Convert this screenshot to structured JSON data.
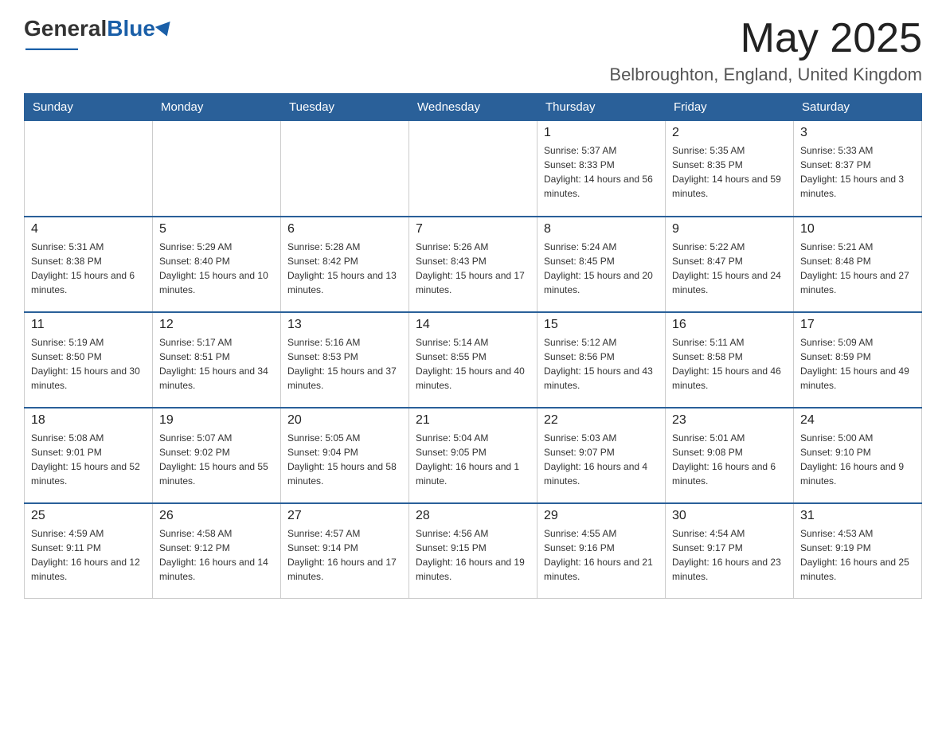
{
  "header": {
    "logo_general": "General",
    "logo_blue": "Blue",
    "month_title": "May 2025",
    "location": "Belbroughton, England, United Kingdom"
  },
  "weekdays": [
    "Sunday",
    "Monday",
    "Tuesday",
    "Wednesday",
    "Thursday",
    "Friday",
    "Saturday"
  ],
  "weeks": [
    [
      {
        "day": "",
        "sunrise": "",
        "sunset": "",
        "daylight": ""
      },
      {
        "day": "",
        "sunrise": "",
        "sunset": "",
        "daylight": ""
      },
      {
        "day": "",
        "sunrise": "",
        "sunset": "",
        "daylight": ""
      },
      {
        "day": "",
        "sunrise": "",
        "sunset": "",
        "daylight": ""
      },
      {
        "day": "1",
        "sunrise": "Sunrise: 5:37 AM",
        "sunset": "Sunset: 8:33 PM",
        "daylight": "Daylight: 14 hours and 56 minutes."
      },
      {
        "day": "2",
        "sunrise": "Sunrise: 5:35 AM",
        "sunset": "Sunset: 8:35 PM",
        "daylight": "Daylight: 14 hours and 59 minutes."
      },
      {
        "day": "3",
        "sunrise": "Sunrise: 5:33 AM",
        "sunset": "Sunset: 8:37 PM",
        "daylight": "Daylight: 15 hours and 3 minutes."
      }
    ],
    [
      {
        "day": "4",
        "sunrise": "Sunrise: 5:31 AM",
        "sunset": "Sunset: 8:38 PM",
        "daylight": "Daylight: 15 hours and 6 minutes."
      },
      {
        "day": "5",
        "sunrise": "Sunrise: 5:29 AM",
        "sunset": "Sunset: 8:40 PM",
        "daylight": "Daylight: 15 hours and 10 minutes."
      },
      {
        "day": "6",
        "sunrise": "Sunrise: 5:28 AM",
        "sunset": "Sunset: 8:42 PM",
        "daylight": "Daylight: 15 hours and 13 minutes."
      },
      {
        "day": "7",
        "sunrise": "Sunrise: 5:26 AM",
        "sunset": "Sunset: 8:43 PM",
        "daylight": "Daylight: 15 hours and 17 minutes."
      },
      {
        "day": "8",
        "sunrise": "Sunrise: 5:24 AM",
        "sunset": "Sunset: 8:45 PM",
        "daylight": "Daylight: 15 hours and 20 minutes."
      },
      {
        "day": "9",
        "sunrise": "Sunrise: 5:22 AM",
        "sunset": "Sunset: 8:47 PM",
        "daylight": "Daylight: 15 hours and 24 minutes."
      },
      {
        "day": "10",
        "sunrise": "Sunrise: 5:21 AM",
        "sunset": "Sunset: 8:48 PM",
        "daylight": "Daylight: 15 hours and 27 minutes."
      }
    ],
    [
      {
        "day": "11",
        "sunrise": "Sunrise: 5:19 AM",
        "sunset": "Sunset: 8:50 PM",
        "daylight": "Daylight: 15 hours and 30 minutes."
      },
      {
        "day": "12",
        "sunrise": "Sunrise: 5:17 AM",
        "sunset": "Sunset: 8:51 PM",
        "daylight": "Daylight: 15 hours and 34 minutes."
      },
      {
        "day": "13",
        "sunrise": "Sunrise: 5:16 AM",
        "sunset": "Sunset: 8:53 PM",
        "daylight": "Daylight: 15 hours and 37 minutes."
      },
      {
        "day": "14",
        "sunrise": "Sunrise: 5:14 AM",
        "sunset": "Sunset: 8:55 PM",
        "daylight": "Daylight: 15 hours and 40 minutes."
      },
      {
        "day": "15",
        "sunrise": "Sunrise: 5:12 AM",
        "sunset": "Sunset: 8:56 PM",
        "daylight": "Daylight: 15 hours and 43 minutes."
      },
      {
        "day": "16",
        "sunrise": "Sunrise: 5:11 AM",
        "sunset": "Sunset: 8:58 PM",
        "daylight": "Daylight: 15 hours and 46 minutes."
      },
      {
        "day": "17",
        "sunrise": "Sunrise: 5:09 AM",
        "sunset": "Sunset: 8:59 PM",
        "daylight": "Daylight: 15 hours and 49 minutes."
      }
    ],
    [
      {
        "day": "18",
        "sunrise": "Sunrise: 5:08 AM",
        "sunset": "Sunset: 9:01 PM",
        "daylight": "Daylight: 15 hours and 52 minutes."
      },
      {
        "day": "19",
        "sunrise": "Sunrise: 5:07 AM",
        "sunset": "Sunset: 9:02 PM",
        "daylight": "Daylight: 15 hours and 55 minutes."
      },
      {
        "day": "20",
        "sunrise": "Sunrise: 5:05 AM",
        "sunset": "Sunset: 9:04 PM",
        "daylight": "Daylight: 15 hours and 58 minutes."
      },
      {
        "day": "21",
        "sunrise": "Sunrise: 5:04 AM",
        "sunset": "Sunset: 9:05 PM",
        "daylight": "Daylight: 16 hours and 1 minute."
      },
      {
        "day": "22",
        "sunrise": "Sunrise: 5:03 AM",
        "sunset": "Sunset: 9:07 PM",
        "daylight": "Daylight: 16 hours and 4 minutes."
      },
      {
        "day": "23",
        "sunrise": "Sunrise: 5:01 AM",
        "sunset": "Sunset: 9:08 PM",
        "daylight": "Daylight: 16 hours and 6 minutes."
      },
      {
        "day": "24",
        "sunrise": "Sunrise: 5:00 AM",
        "sunset": "Sunset: 9:10 PM",
        "daylight": "Daylight: 16 hours and 9 minutes."
      }
    ],
    [
      {
        "day": "25",
        "sunrise": "Sunrise: 4:59 AM",
        "sunset": "Sunset: 9:11 PM",
        "daylight": "Daylight: 16 hours and 12 minutes."
      },
      {
        "day": "26",
        "sunrise": "Sunrise: 4:58 AM",
        "sunset": "Sunset: 9:12 PM",
        "daylight": "Daylight: 16 hours and 14 minutes."
      },
      {
        "day": "27",
        "sunrise": "Sunrise: 4:57 AM",
        "sunset": "Sunset: 9:14 PM",
        "daylight": "Daylight: 16 hours and 17 minutes."
      },
      {
        "day": "28",
        "sunrise": "Sunrise: 4:56 AM",
        "sunset": "Sunset: 9:15 PM",
        "daylight": "Daylight: 16 hours and 19 minutes."
      },
      {
        "day": "29",
        "sunrise": "Sunrise: 4:55 AM",
        "sunset": "Sunset: 9:16 PM",
        "daylight": "Daylight: 16 hours and 21 minutes."
      },
      {
        "day": "30",
        "sunrise": "Sunrise: 4:54 AM",
        "sunset": "Sunset: 9:17 PM",
        "daylight": "Daylight: 16 hours and 23 minutes."
      },
      {
        "day": "31",
        "sunrise": "Sunrise: 4:53 AM",
        "sunset": "Sunset: 9:19 PM",
        "daylight": "Daylight: 16 hours and 25 minutes."
      }
    ]
  ]
}
